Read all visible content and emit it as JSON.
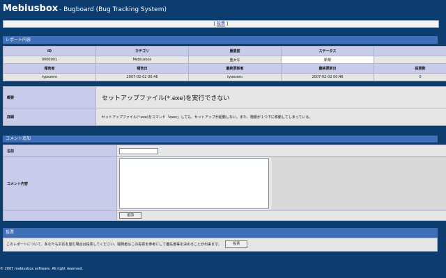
{
  "header": {
    "app_name": "Mebiusbox",
    "subtitle": "- Bugboard (Bug Tracking System)"
  },
  "nav": {
    "open_bracket": "[",
    "vote_link": "投票",
    "close_bracket": "]"
  },
  "report": {
    "section_title": "レポート内容",
    "row1_headers": [
      "ID",
      "カテゴリ",
      "重要度",
      "ステータス",
      ""
    ],
    "row1_values": [
      "0000001",
      "Mebiusbox",
      "重大な",
      "新規",
      ""
    ],
    "row2_headers": [
      "報告者",
      "報告日",
      "最終更新者",
      "最終更新日",
      "投票数"
    ],
    "row2_values": [
      "typezero",
      "2007-02-02 00:46",
      "typezero",
      "2007-02-02 00:46",
      "0"
    ],
    "summary_label": "概要",
    "summary_value": "セットアップファイル(*.exe)を実行できない",
    "details_label": "詳細",
    "details_value": "セットアップファイル(*.exe)をコマンド「exec」しても、セットアップが起動しない。また、階層が１つ下に移動してしまっている。"
  },
  "comment": {
    "section_title": "コメント追加",
    "name_label": "名前",
    "name_value": "",
    "content_label": "コメント内容",
    "content_value": "",
    "add_button": "追加"
  },
  "vote": {
    "section_title": "投票",
    "message": "このレポートについて、あなたも対応を望む場合は投票してください。開発者はこの投票を参考にして優先度等を決めることが出来ます。",
    "button": "投票"
  },
  "footer": {
    "copyright": "© 2007 mebiusbox software. All right reserved."
  }
}
